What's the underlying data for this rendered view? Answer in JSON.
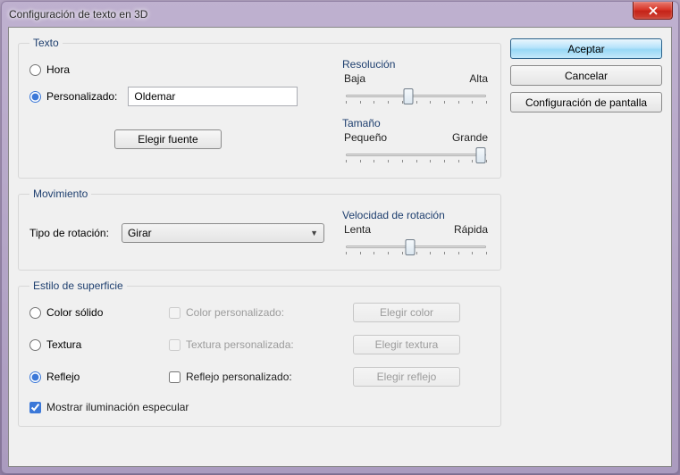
{
  "window": {
    "title": "Configuración de texto en 3D"
  },
  "buttons": {
    "accept": "Aceptar",
    "cancel": "Cancelar",
    "display_settings": "Configuración de pantalla"
  },
  "text_group": {
    "legend": "Texto",
    "radio_time": "Hora",
    "radio_custom": "Personalizado:",
    "custom_value": "Oldemar",
    "choose_font": "Elegir fuente",
    "resolution": {
      "title": "Resolución",
      "low": "Baja",
      "high": "Alta"
    },
    "size": {
      "title": "Tamaño",
      "small": "Pequeño",
      "large": "Grande"
    }
  },
  "motion_group": {
    "legend": "Movimiento",
    "rotation_type_label": "Tipo de rotación:",
    "rotation_type_value": "Girar",
    "speed": {
      "title": "Velocidad de rotación",
      "slow": "Lenta",
      "fast": "Rápida"
    }
  },
  "surface_group": {
    "legend": "Estilo de superficie",
    "radio_solid": "Color sólido",
    "radio_texture": "Textura",
    "radio_reflect": "Reflejo",
    "chk_custom_color": "Color personalizado:",
    "chk_custom_texture": "Textura personalizada:",
    "chk_custom_reflect": "Reflejo personalizado:",
    "btn_color": "Elegir color",
    "btn_texture": "Elegir textura",
    "btn_reflect": "Elegir reflejo",
    "chk_specular": "Mostrar iluminación especular"
  }
}
